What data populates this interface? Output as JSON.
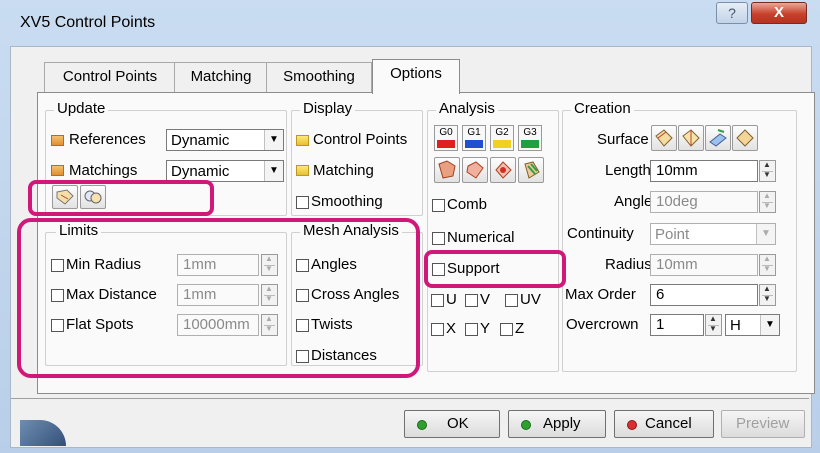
{
  "window": {
    "title": "XV5 Control Points",
    "help_glyph": "?",
    "close_glyph": "X"
  },
  "tabs": [
    {
      "label": "Control Points"
    },
    {
      "label": "Matching"
    },
    {
      "label": "Smoothing"
    },
    {
      "label": "Options"
    }
  ],
  "update": {
    "group_label": "Update",
    "references_label": "References",
    "references_value": "Dynamic",
    "matchings_label": "Matchings",
    "matchings_value": "Dynamic"
  },
  "display": {
    "group_label": "Display",
    "control_points_label": "Control Points",
    "matching_label": "Matching",
    "smoothing_label": "Smoothing"
  },
  "analysis": {
    "group_label": "Analysis",
    "continuity_buttons": [
      "G0",
      "G1",
      "G2",
      "G3"
    ],
    "continuity_colors": [
      "#e02020",
      "#2050d0",
      "#f0d020",
      "#20a040"
    ],
    "comb_label": "Comb",
    "numerical_label": "Numerical",
    "support_label": "Support",
    "u_label": "U",
    "v_label": "V",
    "uv_label": "UV",
    "x_label": "X",
    "y_label": "Y",
    "z_label": "Z"
  },
  "creation": {
    "group_label": "Creation",
    "surface_label": "Surface",
    "length_label": "Length",
    "length_value": "10mm",
    "angle_label": "Angle",
    "angle_value": "10deg",
    "continuity_label": "Continuity",
    "continuity_value": "Point",
    "radius_label": "Radius",
    "radius_value": "10mm",
    "max_order_label": "Max Order",
    "max_order_value": "6",
    "overcrown_label": "Overcrown",
    "overcrown_value": "1",
    "overcrown_axis": "H"
  },
  "limits": {
    "group_label": "Limits",
    "min_radius_label": "Min Radius",
    "min_radius_value": "1mm",
    "max_distance_label": "Max Distance",
    "max_distance_value": "1mm",
    "flat_spots_label": "Flat Spots",
    "flat_spots_value": "10000mm"
  },
  "mesh_analysis": {
    "group_label": "Mesh Analysis",
    "angles_label": "Angles",
    "cross_angles_label": "Cross Angles",
    "twists_label": "Twists",
    "distances_label": "Distances"
  },
  "buttons": {
    "ok": "OK",
    "apply": "Apply",
    "cancel": "Cancel",
    "preview": "Preview"
  },
  "colors": {
    "highlight": "#d0177a",
    "ok_dot": "#2ea02e",
    "apply_dot": "#2ea02e",
    "cancel_dot": "#d83030"
  }
}
